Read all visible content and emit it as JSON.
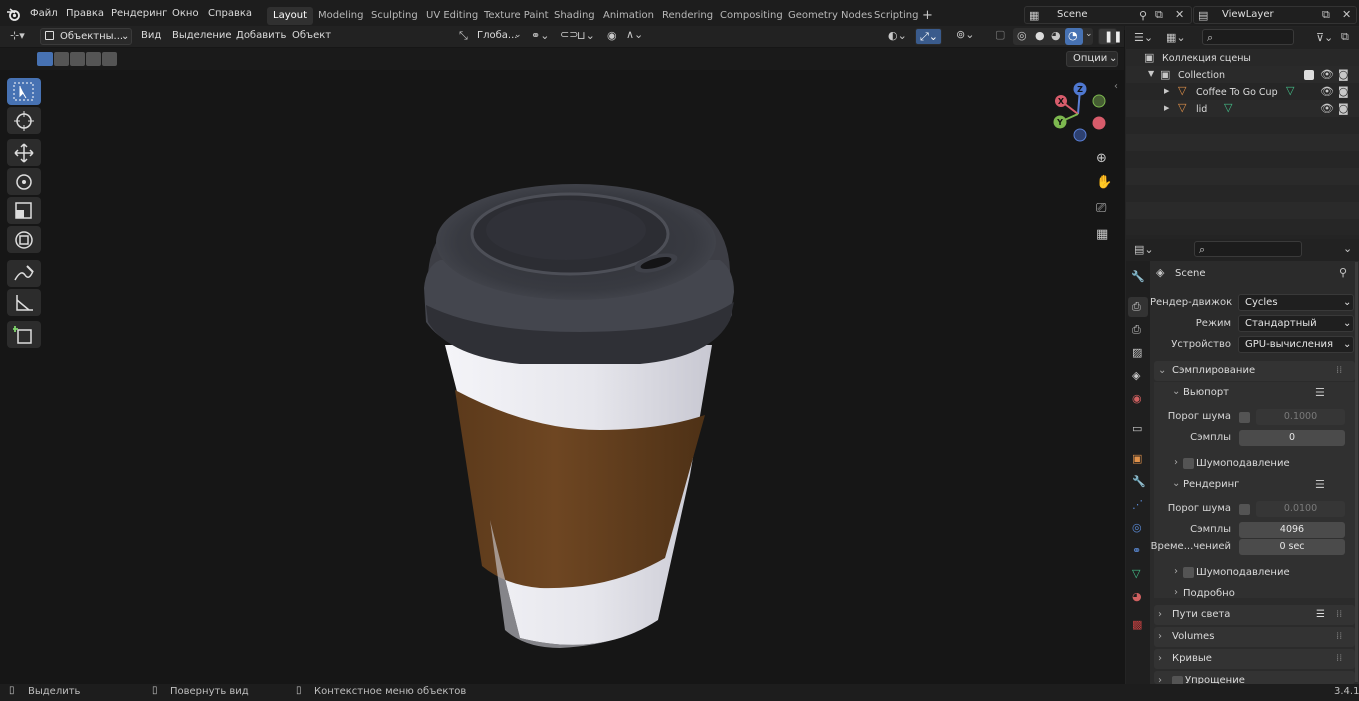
{
  "app": {
    "version": "3.4.1"
  },
  "menu": [
    "Файл",
    "Правка",
    "Рендеринг",
    "Окно",
    "Справка"
  ],
  "workspaces": [
    "Layout",
    "Modeling",
    "Sculpting",
    "UV Editing",
    "Texture Paint",
    "Shading",
    "Animation",
    "Rendering",
    "Compositing",
    "Geometry Nodes",
    "Scripting"
  ],
  "active_workspace": "Layout",
  "scene": {
    "name": "Scene"
  },
  "view_layer": {
    "name": "ViewLayer"
  },
  "viewport_header": {
    "mode": "Объектны...",
    "menus": [
      "Вид",
      "Выделение",
      "Добавить",
      "Объект"
    ],
    "transform_orientation": "Глоба...",
    "options": "Опции"
  },
  "gizmo": {
    "x": "X",
    "y": "Y",
    "z": "Z"
  },
  "outliner": {
    "search_placeholder": "",
    "scene_collection": "Коллекция сцены",
    "collection": "Collection",
    "objects": [
      "Coffee To Go Cup",
      "lid"
    ]
  },
  "properties": {
    "scene_name": "Scene",
    "render_engine_label": "Рендер-движок",
    "render_engine": "Cycles",
    "mode_label": "Режим",
    "mode": "Стандартный",
    "device_label": "Устройство",
    "device": "GPU-вычисления",
    "sampling": "Сэмплирование",
    "viewport": "Вьюпорт",
    "noise_threshold_label": "Порог шума",
    "viewport_noise_threshold": "0.1000",
    "samples_label": "Сэмплы",
    "viewport_samples": "0",
    "denoise": "Шумоподавление",
    "render": "Рендеринг",
    "render_noise_threshold": "0.0100",
    "render_samples": "4096",
    "time_limit_label": "Време...ченией",
    "time_limit": "0 sec",
    "details": "Подробно",
    "panels": [
      "Пути света",
      "Volumes",
      "Кривые",
      "Упрощение"
    ]
  },
  "status_bar": {
    "select": "Выделить",
    "rotate_view": "Повернуть вид",
    "context_menu": "Контекстное меню объектов"
  },
  "colors": {
    "accent": "#4772b3",
    "sleeve": "#6b4421",
    "lid": "#3a3b41",
    "cup": "#e8e8ee"
  }
}
